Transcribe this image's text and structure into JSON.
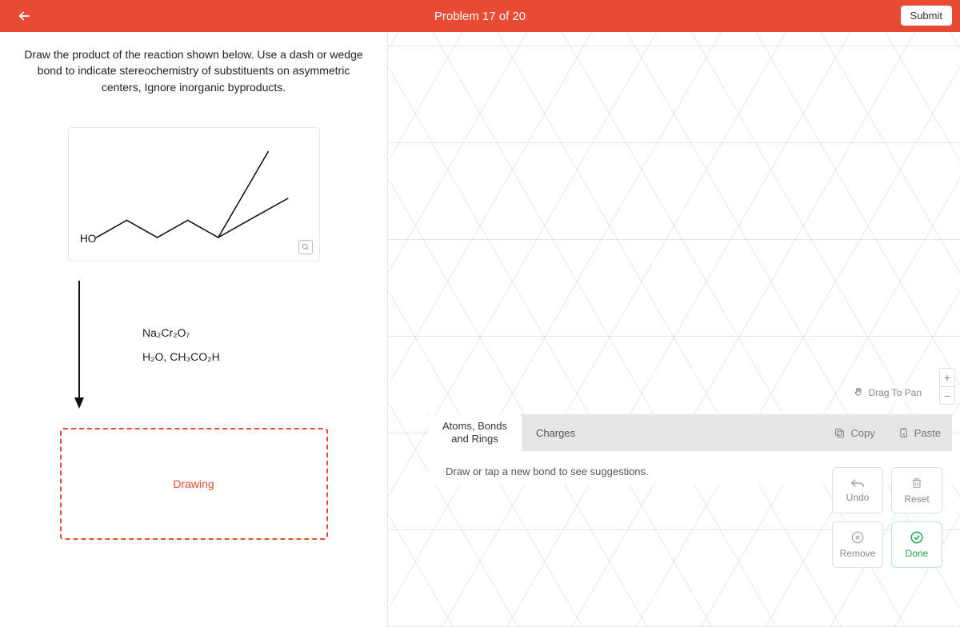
{
  "header": {
    "title": "Problem 17 of 20",
    "submit_label": "Submit"
  },
  "prompt": "Draw the product of the reaction shown below. Use a dash or wedge bond to indicate stereochemistry of substituents on asymmetric centers, Ignore inorganic byproducts.",
  "molecule": {
    "label_left": "HO"
  },
  "reagents": {
    "line1": "Na₂Cr₂O₇",
    "line2": "H₂O, CH₃CO₂H"
  },
  "drawing_target_label": "Drawing",
  "canvas": {
    "drag_label": "Drag To Pan"
  },
  "tabs": {
    "tab1": "Atoms, Bonds\nand Rings",
    "tab2": "Charges",
    "copy_label": "Copy",
    "paste_label": "Paste"
  },
  "hint": "Draw or tap a new bond to see suggestions.",
  "tools": {
    "undo": "Undo",
    "reset": "Reset",
    "remove": "Remove",
    "done": "Done"
  }
}
